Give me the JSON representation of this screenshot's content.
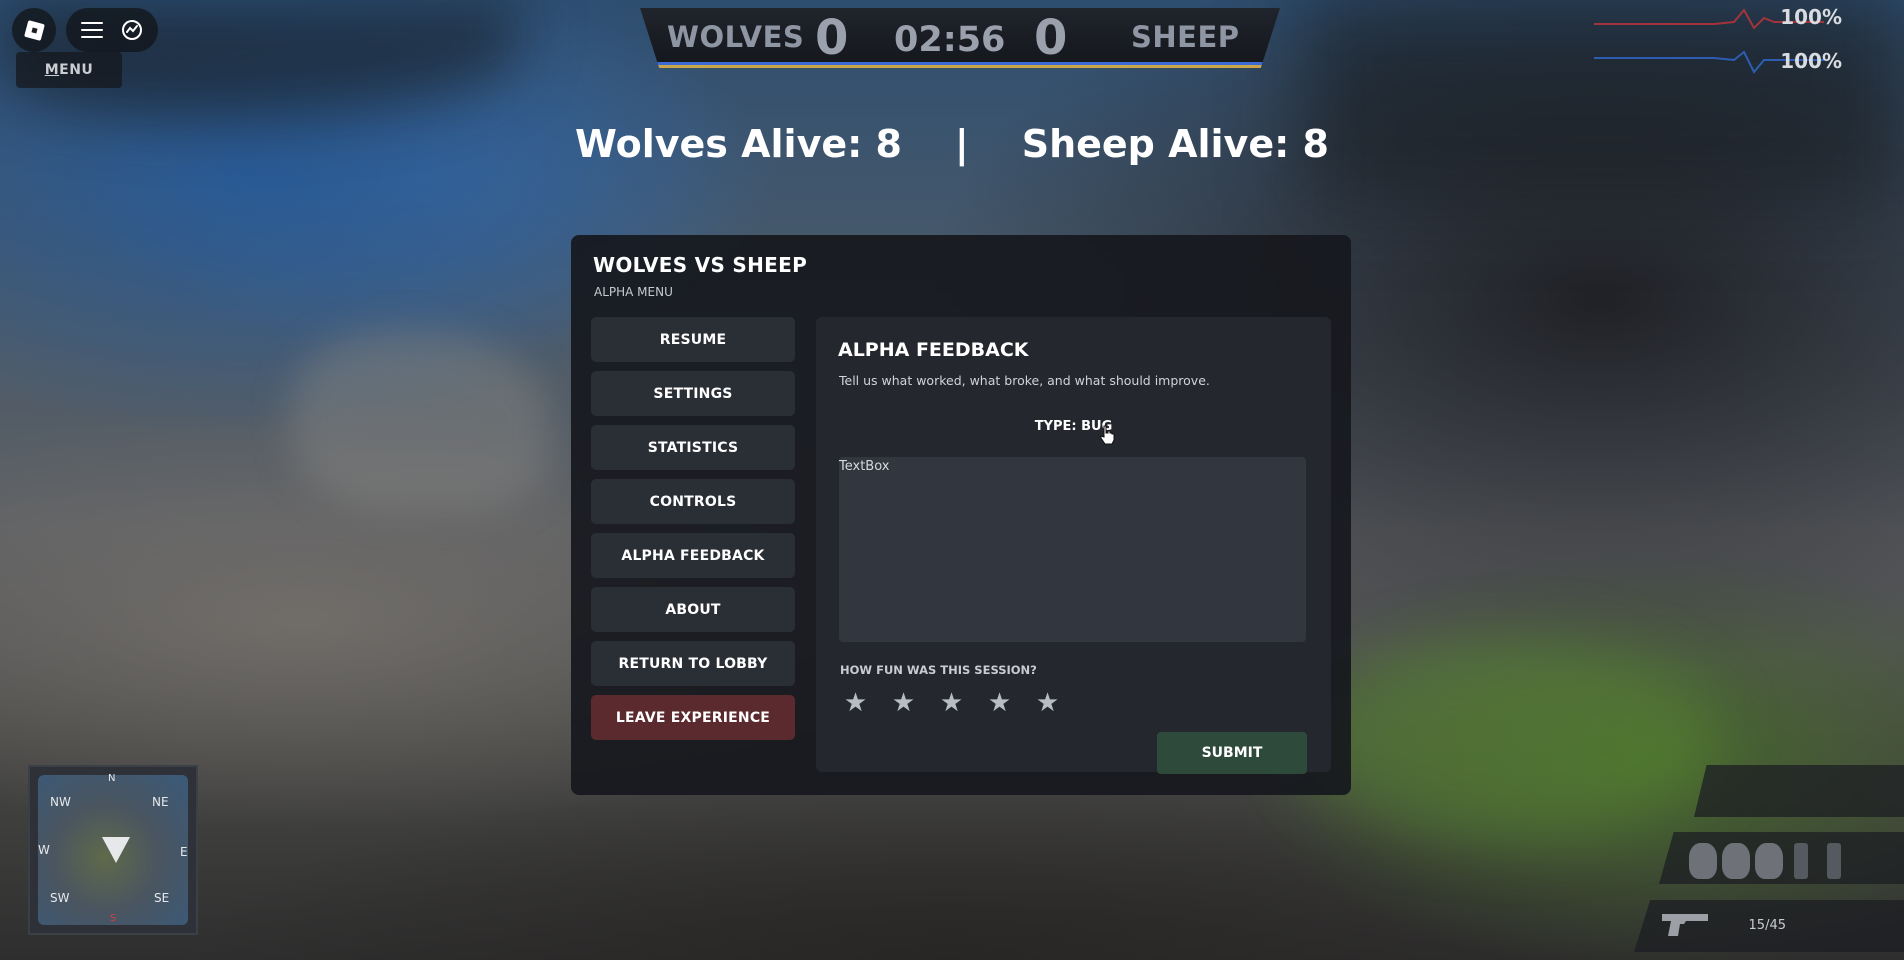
{
  "roblox": {
    "menu_label_underlined": "M",
    "menu_label_rest": "ENU"
  },
  "scoreboard": {
    "team_left": "WOLVES",
    "score_left": "0",
    "timer": "02:56",
    "score_right": "0",
    "team_right": "SHEEP"
  },
  "health": {
    "top": "100%",
    "bottom": "100%",
    "colors": {
      "top": "#d63a3a",
      "bottom": "#3a6fd6"
    }
  },
  "alive_banner": "Wolves Alive: 8    |    Sheep Alive: 8",
  "menu": {
    "title": "WOLVES VS SHEEP",
    "subtitle": "ALPHA MENU",
    "nav": [
      {
        "label": "RESUME"
      },
      {
        "label": "SETTINGS"
      },
      {
        "label": "STATISTICS"
      },
      {
        "label": "CONTROLS"
      },
      {
        "label": "ALPHA FEEDBACK"
      },
      {
        "label": "ABOUT"
      },
      {
        "label": "RETURN TO LOBBY"
      },
      {
        "label": "LEAVE EXPERIENCE"
      }
    ]
  },
  "feedback": {
    "title": "ALPHA FEEDBACK",
    "description": "Tell us what worked, what broke, and what should improve.",
    "type_label": "TYPE: BUG",
    "textbox_placeholder": "TextBox",
    "rating_question": "HOW FUN WAS THIS SESSION?",
    "rating_max": 5,
    "rating_selected": 0,
    "star_glyph": "★",
    "submit_label": "SUBMIT"
  },
  "minimap": {
    "n": "N",
    "ne": "NE",
    "nw": "NW",
    "e": "E",
    "w": "W",
    "se": "SE",
    "sw": "SW",
    "s": "S"
  },
  "hud": {
    "ammo": "15/45"
  }
}
